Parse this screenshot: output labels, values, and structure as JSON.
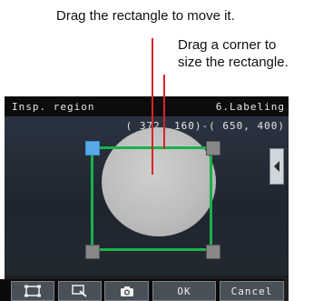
{
  "annotations": {
    "move_hint": "Drag the rectangle to move it.",
    "size_hint_line1": "Drag a corner to",
    "size_hint_line2": "size the rectangle."
  },
  "header": {
    "title": "Insp. region",
    "mode": "6.Labeling",
    "coordinates": "( 372, 160)-( 650, 400)"
  },
  "toolbar": {
    "region_icon": "region-icon",
    "zoom_icon": "zoom-icon",
    "camera_icon": "camera-icon",
    "ok_label": "OK",
    "cancel_label": "Cancel"
  },
  "colors": {
    "selection_border": "#19b34a",
    "active_handle": "#5aa8e8",
    "leader_line": "#d9232e"
  }
}
